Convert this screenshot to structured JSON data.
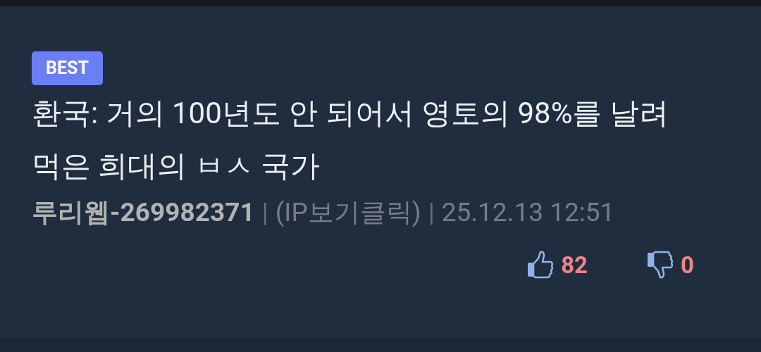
{
  "badge": "BEST",
  "title": "환국: 거의 100년도 안 되어서 영토의 98%를 날려 먹은 희대의 ㅂㅅ 국가",
  "meta": {
    "author": "루리웹-269982371",
    "separator_1": "|",
    "ip_link": "(IP보기클릭)",
    "separator_2": "|",
    "date": "25.12.13 12:51"
  },
  "votes": [
    {
      "kind": "up",
      "count": "82"
    },
    {
      "kind": "down",
      "count": "0"
    }
  ]
}
